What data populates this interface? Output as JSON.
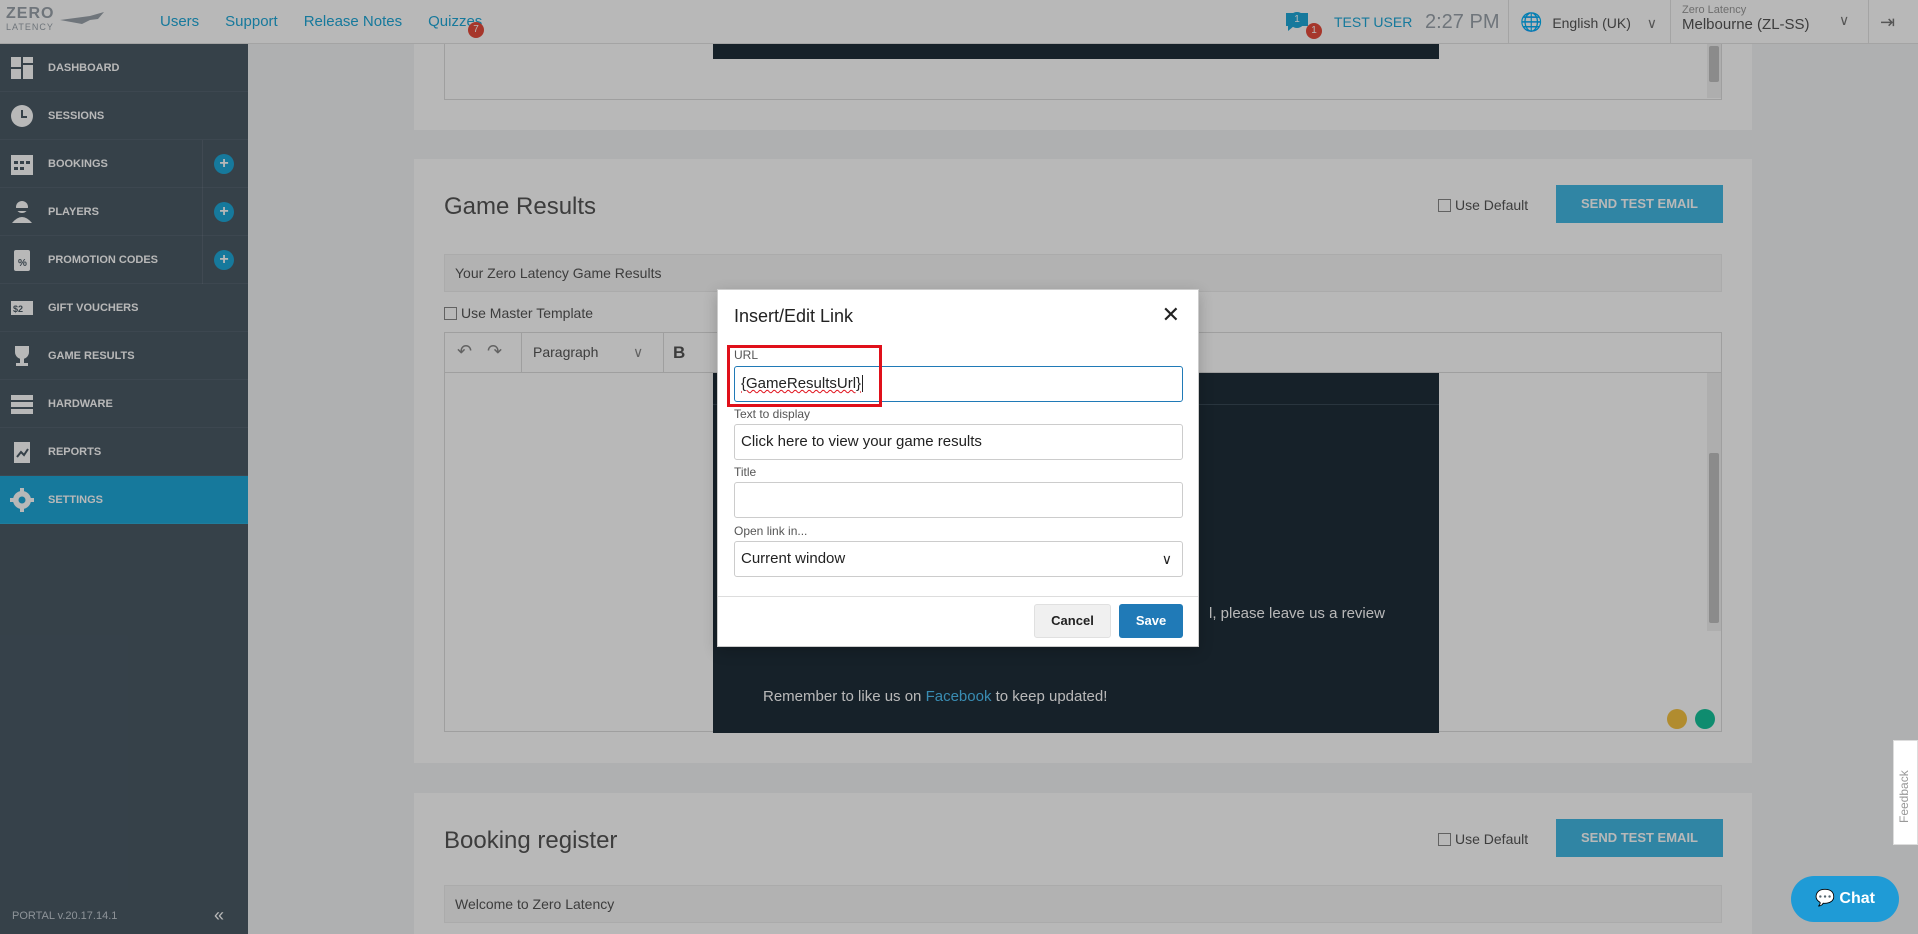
{
  "topbar": {
    "logo_line1": "ZERO",
    "logo_line2": "LATENCY",
    "nav": [
      "Users",
      "Support",
      "Release Notes",
      "Quizzes"
    ],
    "quizzes_badge": "7",
    "chat_badge_1": "1",
    "chat_badge_2": "1",
    "user": "TEST USER",
    "time": "2:27 PM",
    "language": "English (UK)",
    "org_small": "Zero Latency",
    "location": "Melbourne (ZL-SS)"
  },
  "sidebar": {
    "items": [
      {
        "label": "DASHBOARD",
        "icon": "dashboard-icon"
      },
      {
        "label": "SESSIONS",
        "icon": "clock-icon"
      },
      {
        "label": "BOOKINGS",
        "icon": "calendar-icon"
      },
      {
        "label": "PLAYERS",
        "icon": "player-icon"
      },
      {
        "label": "PROMOTION CODES",
        "icon": "promo-icon"
      },
      {
        "label": "GIFT VOUCHERS",
        "icon": "voucher-icon"
      },
      {
        "label": "GAME RESULTS",
        "icon": "trophy-icon"
      },
      {
        "label": "HARDWARE",
        "icon": "hardware-icon"
      },
      {
        "label": "REPORTS",
        "icon": "reports-icon"
      },
      {
        "label": "SETTINGS",
        "icon": "gear-icon"
      }
    ],
    "version": "PORTAL v.20.17.14.1"
  },
  "sections": {
    "game_results": {
      "title": "Game Results",
      "use_default": "Use Default",
      "send_test": "SEND TEST EMAIL",
      "subject": "Your Zero Latency Game Results",
      "use_master": "Use Master Template",
      "format": "Paragraph",
      "review_text": "l, please leave us a review",
      "like_text_pre": "Remember to like us on ",
      "like_link": "Facebook",
      "like_text_post": " to keep updated!"
    },
    "booking_register": {
      "title": "Booking register",
      "use_default": "Use Default",
      "send_test": "SEND TEST EMAIL",
      "subject": "Welcome to Zero Latency"
    }
  },
  "modal": {
    "title": "Insert/Edit Link",
    "url_label": "URL",
    "url_value": "{GameResultsUrl}",
    "text_label": "Text to display",
    "text_value": "Click here to view your game results",
    "title_label": "Title",
    "title_value": "",
    "open_label": "Open link in...",
    "open_value": "Current window",
    "cancel": "Cancel",
    "save": "Save"
  },
  "chat": {
    "label": "Chat"
  },
  "feedback": {
    "label": "Feedback"
  }
}
